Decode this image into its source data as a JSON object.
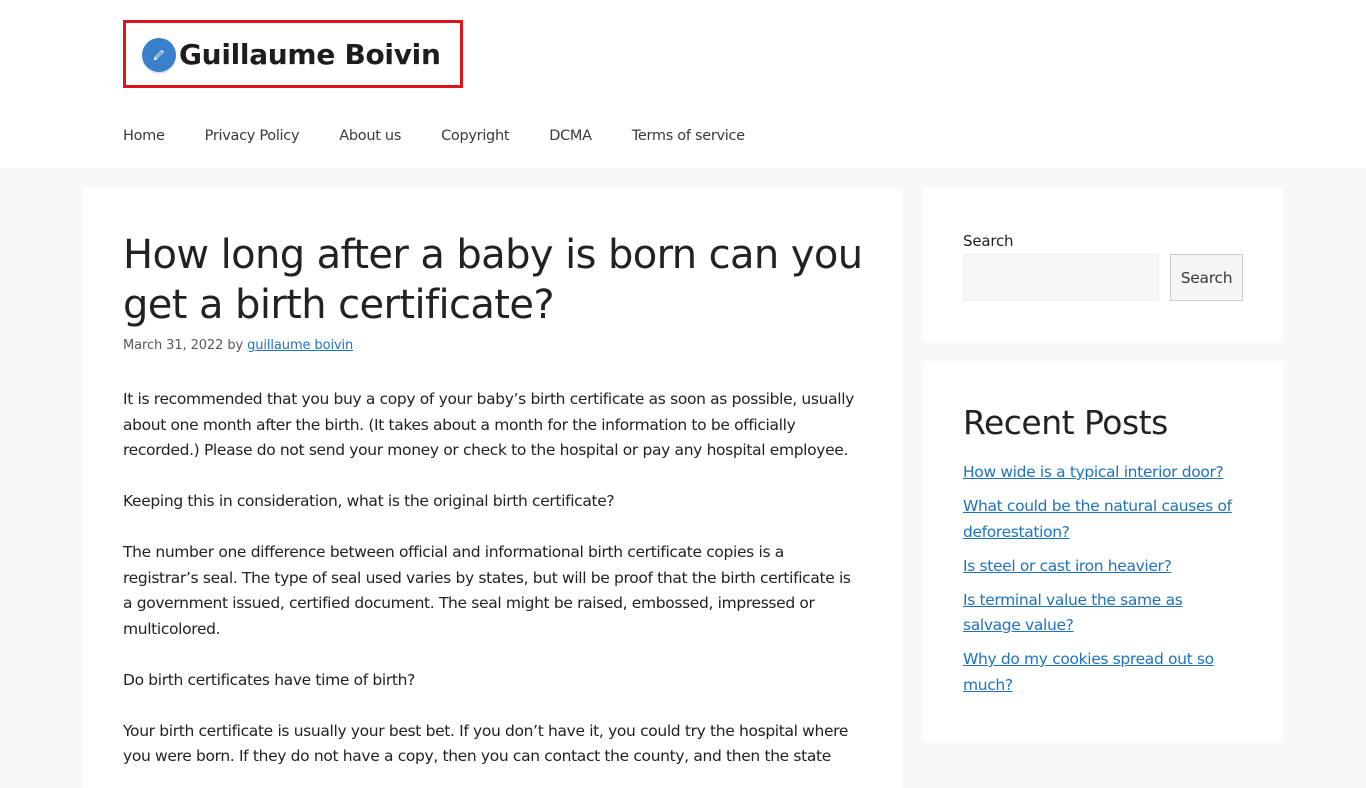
{
  "header": {
    "site_title": "Guillaume Boivin",
    "logo_icon": "pencil-icon",
    "nav": [
      {
        "label": "Home"
      },
      {
        "label": "Privacy Policy"
      },
      {
        "label": "About us"
      },
      {
        "label": "Copyright"
      },
      {
        "label": "DCMA"
      },
      {
        "label": "Terms of service"
      }
    ]
  },
  "article": {
    "title": "How long after a baby is born can you get a birth certificate?",
    "date": "March 31, 2022",
    "by": "by",
    "author": "guillaume boivin",
    "paragraphs": [
      "It is recommended that you buy a copy of your baby’s birth certificate as soon as possible, usually about one month after the birth. (It takes about a month for the information to be officially recorded.) Please do not send your money or check to the hospital or pay any hospital employee.",
      "Keeping this in consideration, what is the original birth certificate?",
      "The number one difference between official and informational birth certificate copies is a registrar’s seal. The type of seal used varies by states, but will be proof that the birth certificate is a government issued, certified document. The seal might be raised, embossed, impressed or multicolored.",
      "Do birth certificates have time of birth?",
      "Your birth certificate is usually your best bet. If you don’t have it, you could try the hospital where you were born. If they do not have a copy, then you can contact the county, and then the state"
    ]
  },
  "sidebar": {
    "search": {
      "label": "Search",
      "value": "",
      "placeholder": "",
      "button_label": "Search"
    },
    "recent_posts": {
      "title": "Recent Posts",
      "items": [
        {
          "label": "How wide is a typical interior door?"
        },
        {
          "label": "What could be the natural causes of deforestation?"
        },
        {
          "label": "Is steel or cast iron heavier?"
        },
        {
          "label": "Is terminal value the same as salvage value?"
        },
        {
          "label": "Why do my cookies spread out so much?"
        }
      ]
    }
  },
  "colors": {
    "accent_link": "#1e73be",
    "logo_blue": "#3a7fcb",
    "highlight_border": "#e0141b",
    "page_background": "#f6f8fa"
  }
}
